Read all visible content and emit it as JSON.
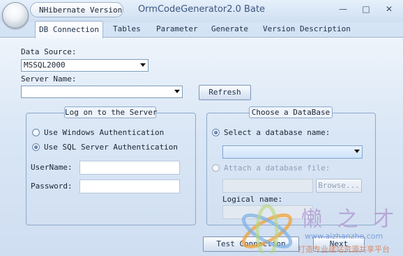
{
  "app": {
    "menu_button": "NHibernate Version",
    "title": "OrmCodeGenerator2.0 Bate",
    "minimize": "—",
    "maximize": "□",
    "close": "✕"
  },
  "tabs": [
    {
      "label": "DB Connection",
      "active": true
    },
    {
      "label": "Tables",
      "active": false
    },
    {
      "label": "Parameter",
      "active": false
    },
    {
      "label": "Generate",
      "active": false
    },
    {
      "label": "Version Description",
      "active": false
    }
  ],
  "connection": {
    "data_source_label": "Data Source:",
    "data_source_value": "MSSQL2000",
    "server_name_label": "Server Name:",
    "server_name_value": "",
    "refresh_label": "Refresh"
  },
  "logon": {
    "title": "Log on to the Server",
    "windows_auth_label": "Use Windows Authentication",
    "windows_auth_selected": false,
    "sql_auth_label": "Use SQL Server Authentication",
    "sql_auth_selected": true,
    "username_label": "UserName:",
    "username_value": "",
    "password_label": "Password:",
    "password_value": ""
  },
  "database": {
    "title": "Choose a DataBase",
    "select_db_label": "Select a database name:",
    "select_db_selected": true,
    "select_db_value": "",
    "attach_label": "Attach a database file:",
    "attach_selected": false,
    "attach_path": "",
    "browse_label": "Browse...",
    "logical_name_label": "Logical name:",
    "logical_name_value": ""
  },
  "actions": {
    "test_connection_label": "Test Connection",
    "next_label": "Next"
  },
  "watermark": {
    "logo_text": "懒 之 才",
    "url": "www.aizhanzhe.com",
    "slogan": "打造专业建站资源共享平台"
  },
  "colors": {
    "window_bg": "#c6d9ef",
    "title_text": "#3b5680",
    "accent_border": "#8ea9cc"
  }
}
